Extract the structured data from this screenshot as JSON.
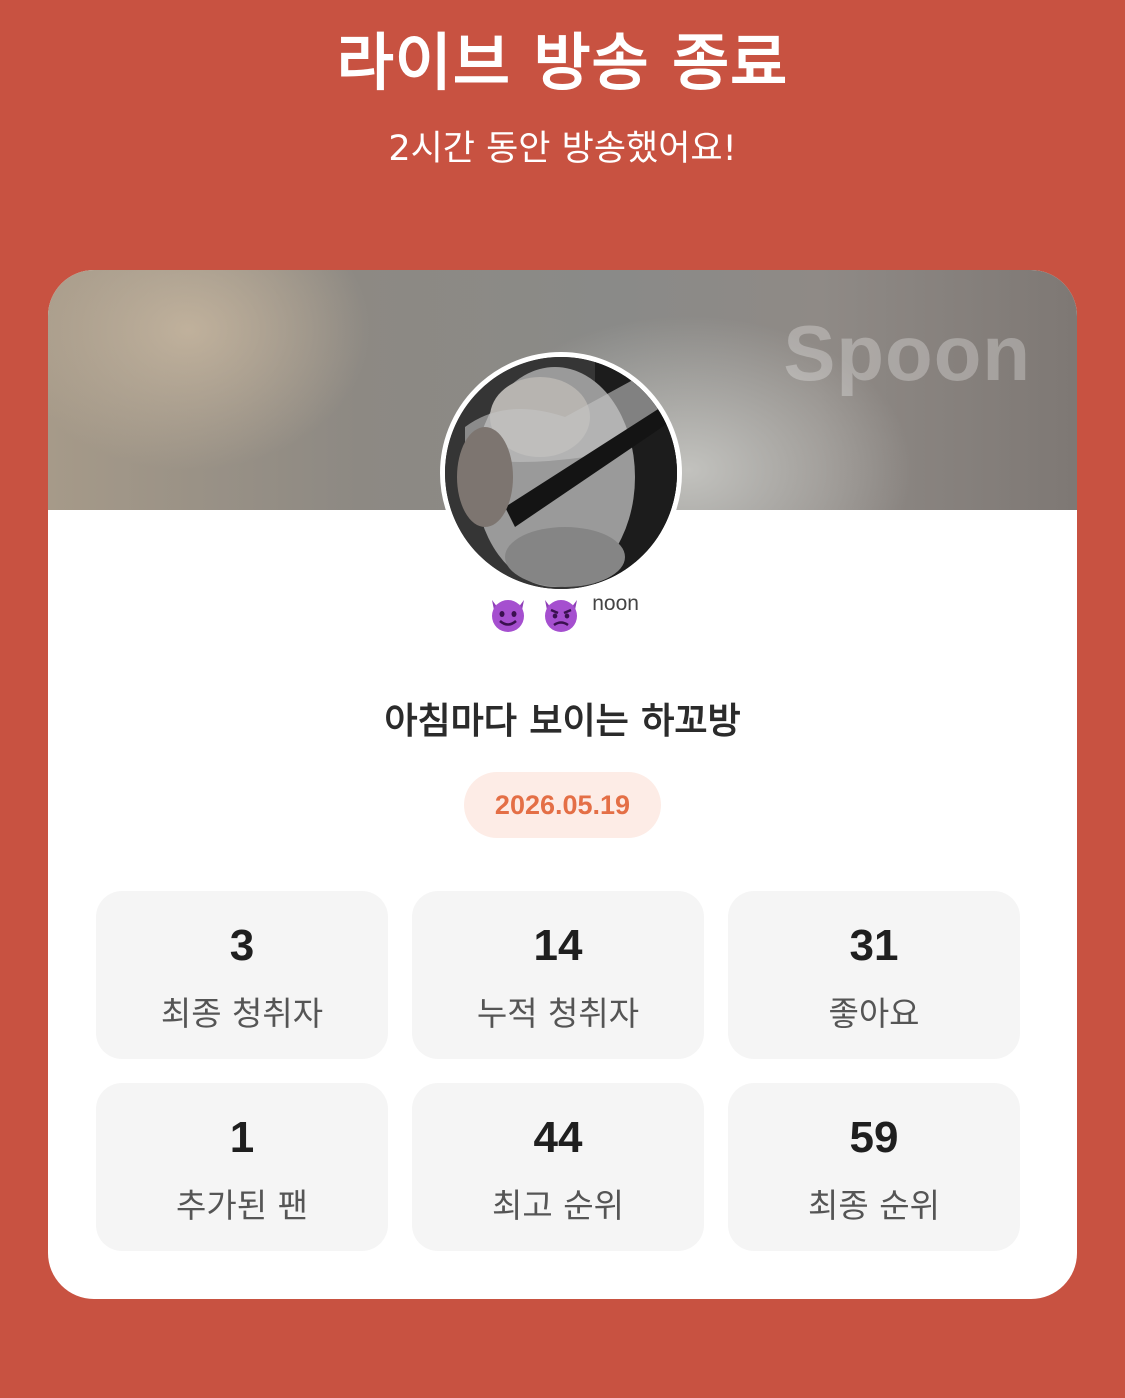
{
  "header": {
    "title": "라이브 방송 종료",
    "subtitle": "2시간 동안 방송했어요!"
  },
  "card": {
    "watermark": "Spoon",
    "nickname": "noon",
    "nickname_emojis": [
      "smiling-devil",
      "angry-devil"
    ],
    "room_title": "아침마다 보이는 하꼬방",
    "date": "2026.05.19",
    "stats": [
      {
        "value": "3",
        "label": "최종 청취자"
      },
      {
        "value": "14",
        "label": "누적 청취자"
      },
      {
        "value": "31",
        "label": "좋아요"
      },
      {
        "value": "1",
        "label": "추가된 팬"
      },
      {
        "value": "44",
        "label": "최고 순위"
      },
      {
        "value": "59",
        "label": "최종 순위"
      }
    ]
  },
  "colors": {
    "background": "#c85241",
    "date_text": "#e46f46",
    "date_pill": "#fdece6",
    "stat_box": "#f5f5f5"
  }
}
